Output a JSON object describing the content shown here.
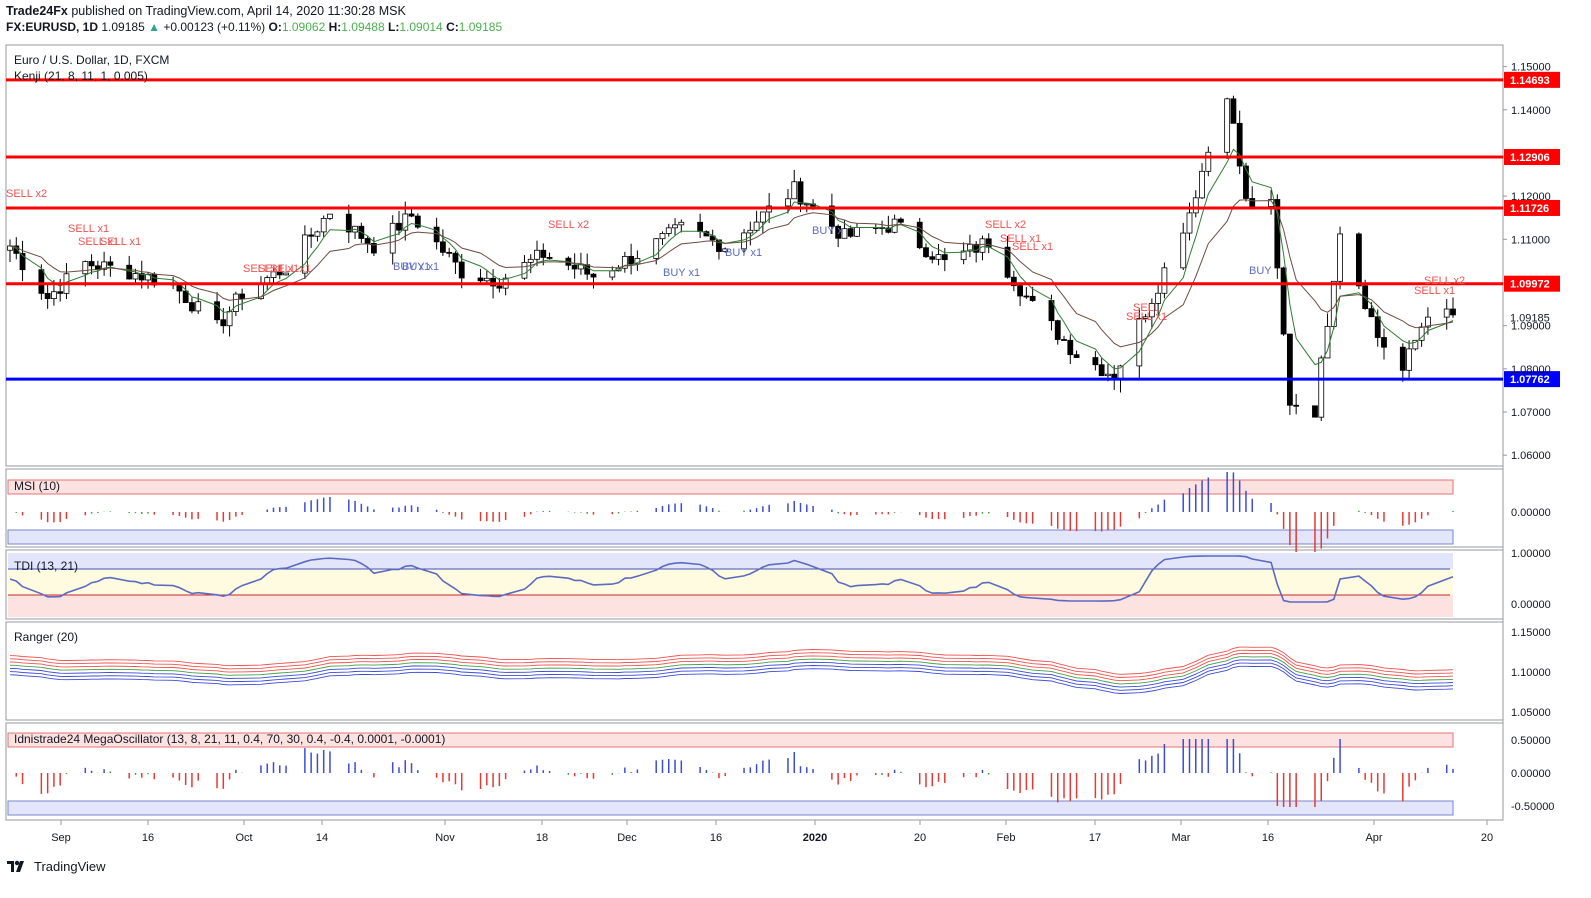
{
  "header": {
    "publisher": "Trade24Fx",
    "published_text": "published on TradingView.com, April 14, 2020 11:30:28 MSK",
    "symbol": "FX:EURUSD, 1D",
    "last": "1.09185",
    "change_arrow": "▲",
    "change": "+0.00123 (+0.11%)",
    "o_label": "O:",
    "o": "1.09062",
    "h_label": "H:",
    "h": "1.09488",
    "l_label": "L:",
    "l": "1.09014",
    "c_label": "C:",
    "c": "1.09185"
  },
  "main_pane": {
    "title": "Euro / U.S. Dollar, 1D, FXCM",
    "indicator": "Kenji (21, 8, 11, 1, 0.005)",
    "y_ticks": [
      "1.15000",
      "1.14000",
      "1.12000",
      "1.11000",
      "1.09000",
      "1.08000",
      "1.07000",
      "1.06000"
    ],
    "levels": [
      {
        "value": 1.14693,
        "label": "1.14693",
        "color": "#ff0000"
      },
      {
        "value": 1.12906,
        "label": "1.12906",
        "color": "#ff0000"
      },
      {
        "value": 1.11726,
        "label": "1.11726",
        "color": "#ff0000"
      },
      {
        "value": 1.09972,
        "label": "1.09972",
        "color": "#ff0000"
      },
      {
        "value": 1.07762,
        "label": "1.07762",
        "color": "#0000ff"
      }
    ],
    "last_price_label": "1.09185",
    "signals": [
      {
        "text": "SELL x2",
        "color": "#ef5350"
      },
      {
        "text": "SELL x1",
        "color": "#ef5350"
      },
      {
        "text": "SELL x1",
        "color": "#ef5350"
      },
      {
        "text": "SELL x1",
        "color": "#ef5350"
      },
      {
        "text": "SELL x1",
        "color": "#ef5350"
      },
      {
        "text": "SELL x1",
        "color": "#ef5350"
      },
      {
        "text": "SELL x1",
        "color": "#ef5350"
      },
      {
        "text": "BUY x1",
        "color": "#5c6bc0"
      },
      {
        "text": "BUY x1",
        "color": "#5c6bc0"
      },
      {
        "text": "SELL x2",
        "color": "#ef5350"
      },
      {
        "text": "BUY x1",
        "color": "#5c6bc0"
      },
      {
        "text": "BUY x1",
        "color": "#5c6bc0"
      },
      {
        "text": "BUY x",
        "color": "#5c6bc0"
      },
      {
        "text": "SELL x2",
        "color": "#ef5350"
      },
      {
        "text": "SELL x1",
        "color": "#ef5350"
      },
      {
        "text": "SELL x1",
        "color": "#ef5350"
      },
      {
        "text": "SELL",
        "color": "#ef5350"
      },
      {
        "text": "SELL x1",
        "color": "#ef5350"
      },
      {
        "text": "BUY",
        "color": "#5c6bc0"
      },
      {
        "text": "SELL x2",
        "color": "#ef5350"
      },
      {
        "text": "SELL x1",
        "color": "#ef5350"
      }
    ]
  },
  "panes": {
    "msi": {
      "title": "MSI (10)",
      "y_ticks": [
        "0.00000"
      ]
    },
    "tdi": {
      "title": "TDI (13, 21)",
      "y_ticks": [
        "1.00000",
        "0.00000"
      ]
    },
    "ranger": {
      "title": "Ranger (20)",
      "y_ticks": [
        "1.15000",
        "1.10000",
        "1.05000"
      ]
    },
    "mega": {
      "title": "Idnistrade24 MegaOscillator (13, 8, 21, 11, 0.4, 70, 30, 0.4, -0.4, 0.0001, -0.0001)",
      "y_ticks": [
        "0.50000",
        "0.00000",
        "-0.50000"
      ]
    }
  },
  "x_axis": {
    "labels": [
      "Sep",
      "16",
      "Oct",
      "14",
      "Nov",
      "18",
      "Dec",
      "16",
      "2020",
      "20",
      "Feb",
      "17",
      "Mar",
      "16",
      "Apr",
      "20"
    ]
  },
  "footer": {
    "brand": "TradingView"
  },
  "colors": {
    "up": "#26a69a",
    "bull_candle": "#ffffff",
    "bear_candle": "#000000",
    "resistance": "#ff0000",
    "support": "#0000ff",
    "sell": "#ef5350",
    "buy": "#5c6bc0"
  },
  "chart_data": {
    "type": "line",
    "title": "Euro / U.S. Dollar, 1D, FXCM",
    "x_range": [
      "2019-08-28",
      "2020-04-14"
    ],
    "ylim": [
      1.0575,
      1.155
    ],
    "close_anchors": [
      {
        "x": "2019-08-28",
        "y": 1.1085
      },
      {
        "x": "2019-09-03",
        "y": 1.0965
      },
      {
        "x": "2019-09-09",
        "y": 1.1045
      },
      {
        "x": "2019-09-16",
        "y": 1.1025
      },
      {
        "x": "2019-09-23",
        "y": 1.0995
      },
      {
        "x": "2019-09-30",
        "y": 1.0895
      },
      {
        "x": "2019-10-04",
        "y": 1.0975
      },
      {
        "x": "2019-10-11",
        "y": 1.1035
      },
      {
        "x": "2019-10-18",
        "y": 1.1165
      },
      {
        "x": "2019-10-25",
        "y": 1.1085
      },
      {
        "x": "2019-10-31",
        "y": 1.1155
      },
      {
        "x": "2019-11-08",
        "y": 1.1025
      },
      {
        "x": "2019-11-14",
        "y": 1.1005
      },
      {
        "x": "2019-11-21",
        "y": 1.1065
      },
      {
        "x": "2019-11-29",
        "y": 1.1015
      },
      {
        "x": "2019-12-06",
        "y": 1.1065
      },
      {
        "x": "2019-12-13",
        "y": 1.1125
      },
      {
        "x": "2019-12-20",
        "y": 1.1085
      },
      {
        "x": "2019-12-31",
        "y": 1.1215
      },
      {
        "x": "2020-01-08",
        "y": 1.1105
      },
      {
        "x": "2020-01-16",
        "y": 1.1135
      },
      {
        "x": "2020-01-24",
        "y": 1.1045
      },
      {
        "x": "2020-01-31",
        "y": 1.1095
      },
      {
        "x": "2020-02-07",
        "y": 1.0945
      },
      {
        "x": "2020-02-14",
        "y": 1.0835
      },
      {
        "x": "2020-02-20",
        "y": 1.0785
      },
      {
        "x": "2020-02-27",
        "y": 1.0995
      },
      {
        "x": "2020-03-03",
        "y": 1.1165
      },
      {
        "x": "2020-03-09",
        "y": 1.1445
      },
      {
        "x": "2020-03-12",
        "y": 1.1185
      },
      {
        "x": "2020-03-16",
        "y": 1.1175
      },
      {
        "x": "2020-03-19",
        "y": 1.0725
      },
      {
        "x": "2020-03-23",
        "y": 1.0705
      },
      {
        "x": "2020-03-27",
        "y": 1.1125
      },
      {
        "x": "2020-04-02",
        "y": 1.0875
      },
      {
        "x": "2020-04-06",
        "y": 1.0795
      },
      {
        "x": "2020-04-10",
        "y": 1.0935
      },
      {
        "x": "2020-04-14",
        "y": 1.09185
      }
    ]
  }
}
